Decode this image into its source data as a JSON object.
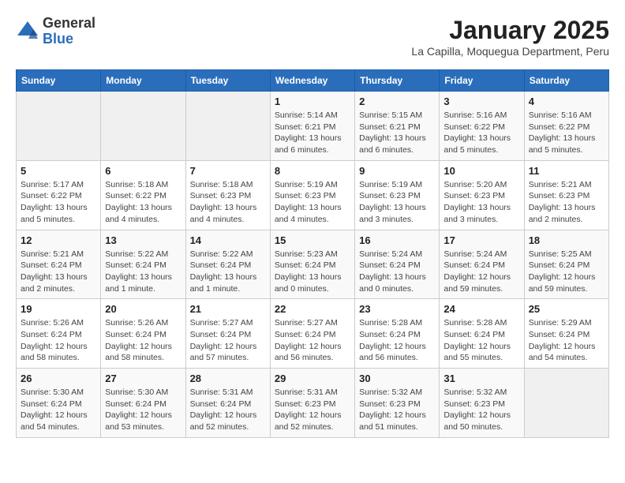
{
  "header": {
    "logo_general": "General",
    "logo_blue": "Blue",
    "month_title": "January 2025",
    "subtitle": "La Capilla, Moquegua Department, Peru"
  },
  "weekdays": [
    "Sunday",
    "Monday",
    "Tuesday",
    "Wednesday",
    "Thursday",
    "Friday",
    "Saturday"
  ],
  "weeks": [
    [
      {
        "day": "",
        "info": ""
      },
      {
        "day": "",
        "info": ""
      },
      {
        "day": "",
        "info": ""
      },
      {
        "day": "1",
        "info": "Sunrise: 5:14 AM\nSunset: 6:21 PM\nDaylight: 13 hours\nand 6 minutes."
      },
      {
        "day": "2",
        "info": "Sunrise: 5:15 AM\nSunset: 6:21 PM\nDaylight: 13 hours\nand 6 minutes."
      },
      {
        "day": "3",
        "info": "Sunrise: 5:16 AM\nSunset: 6:22 PM\nDaylight: 13 hours\nand 5 minutes."
      },
      {
        "day": "4",
        "info": "Sunrise: 5:16 AM\nSunset: 6:22 PM\nDaylight: 13 hours\nand 5 minutes."
      }
    ],
    [
      {
        "day": "5",
        "info": "Sunrise: 5:17 AM\nSunset: 6:22 PM\nDaylight: 13 hours\nand 5 minutes."
      },
      {
        "day": "6",
        "info": "Sunrise: 5:18 AM\nSunset: 6:22 PM\nDaylight: 13 hours\nand 4 minutes."
      },
      {
        "day": "7",
        "info": "Sunrise: 5:18 AM\nSunset: 6:23 PM\nDaylight: 13 hours\nand 4 minutes."
      },
      {
        "day": "8",
        "info": "Sunrise: 5:19 AM\nSunset: 6:23 PM\nDaylight: 13 hours\nand 4 minutes."
      },
      {
        "day": "9",
        "info": "Sunrise: 5:19 AM\nSunset: 6:23 PM\nDaylight: 13 hours\nand 3 minutes."
      },
      {
        "day": "10",
        "info": "Sunrise: 5:20 AM\nSunset: 6:23 PM\nDaylight: 13 hours\nand 3 minutes."
      },
      {
        "day": "11",
        "info": "Sunrise: 5:21 AM\nSunset: 6:23 PM\nDaylight: 13 hours\nand 2 minutes."
      }
    ],
    [
      {
        "day": "12",
        "info": "Sunrise: 5:21 AM\nSunset: 6:24 PM\nDaylight: 13 hours\nand 2 minutes."
      },
      {
        "day": "13",
        "info": "Sunrise: 5:22 AM\nSunset: 6:24 PM\nDaylight: 13 hours\nand 1 minute."
      },
      {
        "day": "14",
        "info": "Sunrise: 5:22 AM\nSunset: 6:24 PM\nDaylight: 13 hours\nand 1 minute."
      },
      {
        "day": "15",
        "info": "Sunrise: 5:23 AM\nSunset: 6:24 PM\nDaylight: 13 hours\nand 0 minutes."
      },
      {
        "day": "16",
        "info": "Sunrise: 5:24 AM\nSunset: 6:24 PM\nDaylight: 13 hours\nand 0 minutes."
      },
      {
        "day": "17",
        "info": "Sunrise: 5:24 AM\nSunset: 6:24 PM\nDaylight: 12 hours\nand 59 minutes."
      },
      {
        "day": "18",
        "info": "Sunrise: 5:25 AM\nSunset: 6:24 PM\nDaylight: 12 hours\nand 59 minutes."
      }
    ],
    [
      {
        "day": "19",
        "info": "Sunrise: 5:26 AM\nSunset: 6:24 PM\nDaylight: 12 hours\nand 58 minutes."
      },
      {
        "day": "20",
        "info": "Sunrise: 5:26 AM\nSunset: 6:24 PM\nDaylight: 12 hours\nand 58 minutes."
      },
      {
        "day": "21",
        "info": "Sunrise: 5:27 AM\nSunset: 6:24 PM\nDaylight: 12 hours\nand 57 minutes."
      },
      {
        "day": "22",
        "info": "Sunrise: 5:27 AM\nSunset: 6:24 PM\nDaylight: 12 hours\nand 56 minutes."
      },
      {
        "day": "23",
        "info": "Sunrise: 5:28 AM\nSunset: 6:24 PM\nDaylight: 12 hours\nand 56 minutes."
      },
      {
        "day": "24",
        "info": "Sunrise: 5:28 AM\nSunset: 6:24 PM\nDaylight: 12 hours\nand 55 minutes."
      },
      {
        "day": "25",
        "info": "Sunrise: 5:29 AM\nSunset: 6:24 PM\nDaylight: 12 hours\nand 54 minutes."
      }
    ],
    [
      {
        "day": "26",
        "info": "Sunrise: 5:30 AM\nSunset: 6:24 PM\nDaylight: 12 hours\nand 54 minutes."
      },
      {
        "day": "27",
        "info": "Sunrise: 5:30 AM\nSunset: 6:24 PM\nDaylight: 12 hours\nand 53 minutes."
      },
      {
        "day": "28",
        "info": "Sunrise: 5:31 AM\nSunset: 6:24 PM\nDaylight: 12 hours\nand 52 minutes."
      },
      {
        "day": "29",
        "info": "Sunrise: 5:31 AM\nSunset: 6:23 PM\nDaylight: 12 hours\nand 52 minutes."
      },
      {
        "day": "30",
        "info": "Sunrise: 5:32 AM\nSunset: 6:23 PM\nDaylight: 12 hours\nand 51 minutes."
      },
      {
        "day": "31",
        "info": "Sunrise: 5:32 AM\nSunset: 6:23 PM\nDaylight: 12 hours\nand 50 minutes."
      },
      {
        "day": "",
        "info": ""
      }
    ]
  ]
}
